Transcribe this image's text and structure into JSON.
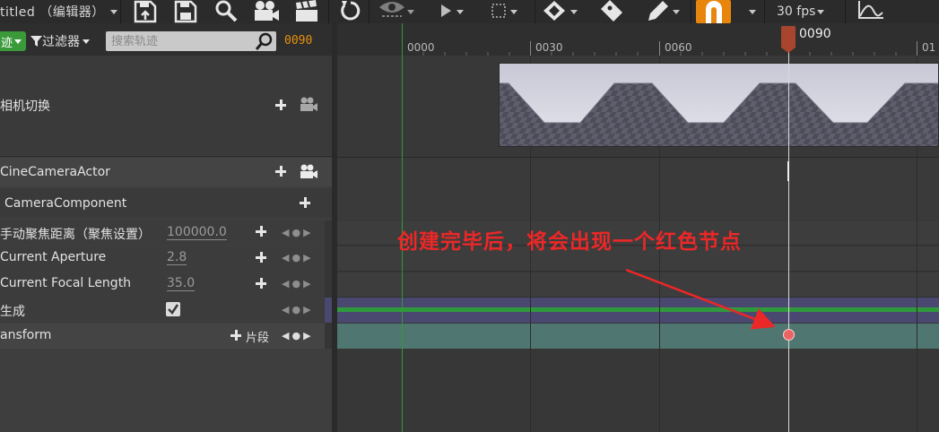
{
  "toolbar": {
    "title": "titled （编辑器）",
    "fps_label": "30 fps",
    "icons": [
      "save-icon",
      "save-as-icon",
      "search-icon",
      "camera-icon",
      "clapper-icon",
      "refresh-icon",
      "eye-icon",
      "play-icon",
      "selection-icon",
      "key-icon",
      "tag-icon",
      "pencil-icon",
      "magnet-icon",
      "curve-icon"
    ],
    "snap_color": "#e8850c"
  },
  "filterbar": {
    "track_button_label": "迹",
    "filter_label": "过滤器",
    "search_placeholder": "搜索轨迹",
    "current_frame": "0090"
  },
  "tracks": {
    "camera_cut": {
      "label": "相机切换"
    },
    "actor": {
      "label": "CineCameraActor"
    },
    "component": {
      "label": "CameraComponent"
    },
    "focus_distance": {
      "label": "手动聚焦距离（聚焦设置）",
      "value": "100000.0"
    },
    "aperture": {
      "label": "Current Aperture",
      "value": "2.8"
    },
    "focal_length": {
      "label": "Current Focal Length",
      "value": "35.0"
    },
    "spawned": {
      "label": "生成",
      "checked": true
    },
    "transform": {
      "label": "ansform",
      "section_label": "片段"
    }
  },
  "timeline": {
    "ticks": [
      "0000",
      "0030",
      "0060",
      "01"
    ],
    "playhead_label": "0090",
    "playhead_color": "#a8452e"
  },
  "annotation": {
    "text": "创建完毕后，将会出现一个红色节点",
    "color": "#ec2727"
  }
}
